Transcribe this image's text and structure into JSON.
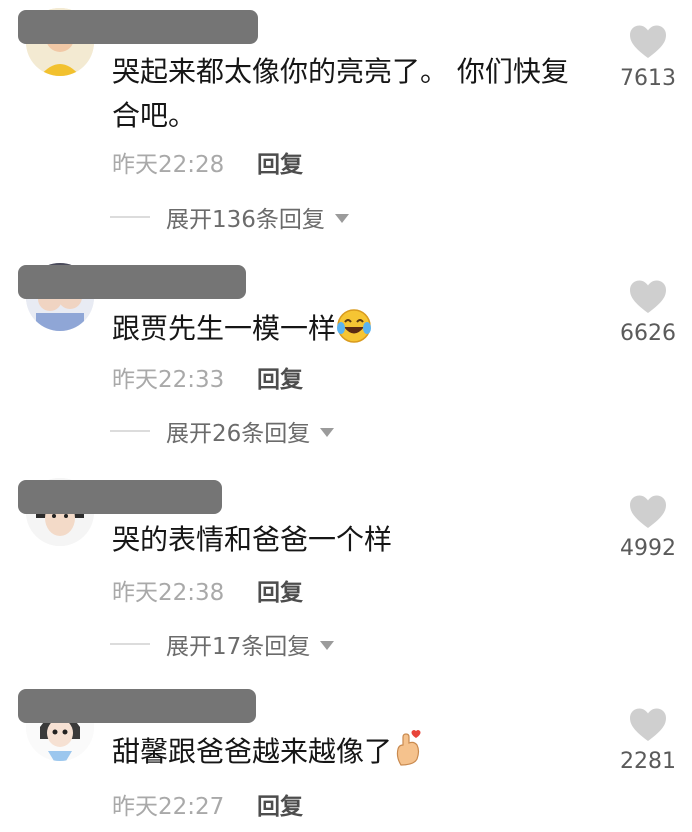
{
  "comments": [
    {
      "text": "哭起来都太像你的亮亮了。 你们快复合吧。",
      "time": "昨天22:28",
      "reply": "回复",
      "expand": "展开136条回复",
      "likes": "7613"
    },
    {
      "text": "跟贾先生一模一样",
      "time": "昨天22:33",
      "reply": "回复",
      "expand": "展开26条回复",
      "likes": "6626",
      "emoji": "laughing-crying-emoji"
    },
    {
      "text": "哭的表情和爸爸一个样",
      "time": "昨天22:38",
      "reply": "回复",
      "expand": "展开17条回复",
      "likes": "4992"
    },
    {
      "text": "甜馨跟爸爸越来越像了",
      "time": "昨天22:27",
      "reply": "回复",
      "likes": "2281",
      "emoji": "finger-heart-emoji"
    }
  ],
  "colors": {
    "text": "#161616",
    "meta": "#a9a9a9",
    "heart": "#cfcfcf",
    "redaction": "#757575"
  }
}
